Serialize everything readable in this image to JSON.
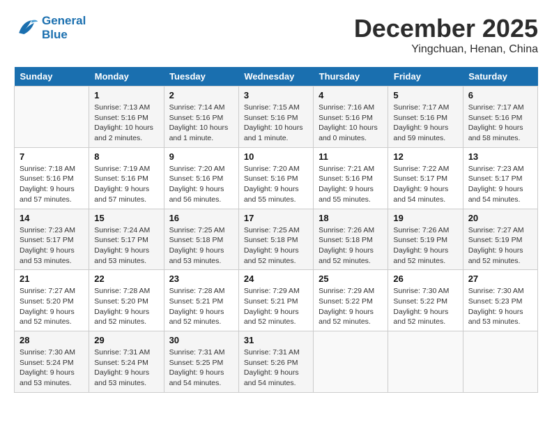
{
  "logo": {
    "line1": "General",
    "line2": "Blue"
  },
  "title": "December 2025",
  "location": "Yingchuan, Henan, China",
  "days_of_week": [
    "Sunday",
    "Monday",
    "Tuesday",
    "Wednesday",
    "Thursday",
    "Friday",
    "Saturday"
  ],
  "weeks": [
    [
      {
        "day": "",
        "info": ""
      },
      {
        "day": "1",
        "info": "Sunrise: 7:13 AM\nSunset: 5:16 PM\nDaylight: 10 hours\nand 2 minutes."
      },
      {
        "day": "2",
        "info": "Sunrise: 7:14 AM\nSunset: 5:16 PM\nDaylight: 10 hours\nand 1 minute."
      },
      {
        "day": "3",
        "info": "Sunrise: 7:15 AM\nSunset: 5:16 PM\nDaylight: 10 hours\nand 1 minute."
      },
      {
        "day": "4",
        "info": "Sunrise: 7:16 AM\nSunset: 5:16 PM\nDaylight: 10 hours\nand 0 minutes."
      },
      {
        "day": "5",
        "info": "Sunrise: 7:17 AM\nSunset: 5:16 PM\nDaylight: 9 hours\nand 59 minutes."
      },
      {
        "day": "6",
        "info": "Sunrise: 7:17 AM\nSunset: 5:16 PM\nDaylight: 9 hours\nand 58 minutes."
      }
    ],
    [
      {
        "day": "7",
        "info": "Sunrise: 7:18 AM\nSunset: 5:16 PM\nDaylight: 9 hours\nand 57 minutes."
      },
      {
        "day": "8",
        "info": "Sunrise: 7:19 AM\nSunset: 5:16 PM\nDaylight: 9 hours\nand 57 minutes."
      },
      {
        "day": "9",
        "info": "Sunrise: 7:20 AM\nSunset: 5:16 PM\nDaylight: 9 hours\nand 56 minutes."
      },
      {
        "day": "10",
        "info": "Sunrise: 7:20 AM\nSunset: 5:16 PM\nDaylight: 9 hours\nand 55 minutes."
      },
      {
        "day": "11",
        "info": "Sunrise: 7:21 AM\nSunset: 5:16 PM\nDaylight: 9 hours\nand 55 minutes."
      },
      {
        "day": "12",
        "info": "Sunrise: 7:22 AM\nSunset: 5:17 PM\nDaylight: 9 hours\nand 54 minutes."
      },
      {
        "day": "13",
        "info": "Sunrise: 7:23 AM\nSunset: 5:17 PM\nDaylight: 9 hours\nand 54 minutes."
      }
    ],
    [
      {
        "day": "14",
        "info": "Sunrise: 7:23 AM\nSunset: 5:17 PM\nDaylight: 9 hours\nand 53 minutes."
      },
      {
        "day": "15",
        "info": "Sunrise: 7:24 AM\nSunset: 5:17 PM\nDaylight: 9 hours\nand 53 minutes."
      },
      {
        "day": "16",
        "info": "Sunrise: 7:25 AM\nSunset: 5:18 PM\nDaylight: 9 hours\nand 53 minutes."
      },
      {
        "day": "17",
        "info": "Sunrise: 7:25 AM\nSunset: 5:18 PM\nDaylight: 9 hours\nand 52 minutes."
      },
      {
        "day": "18",
        "info": "Sunrise: 7:26 AM\nSunset: 5:18 PM\nDaylight: 9 hours\nand 52 minutes."
      },
      {
        "day": "19",
        "info": "Sunrise: 7:26 AM\nSunset: 5:19 PM\nDaylight: 9 hours\nand 52 minutes."
      },
      {
        "day": "20",
        "info": "Sunrise: 7:27 AM\nSunset: 5:19 PM\nDaylight: 9 hours\nand 52 minutes."
      }
    ],
    [
      {
        "day": "21",
        "info": "Sunrise: 7:27 AM\nSunset: 5:20 PM\nDaylight: 9 hours\nand 52 minutes."
      },
      {
        "day": "22",
        "info": "Sunrise: 7:28 AM\nSunset: 5:20 PM\nDaylight: 9 hours\nand 52 minutes."
      },
      {
        "day": "23",
        "info": "Sunrise: 7:28 AM\nSunset: 5:21 PM\nDaylight: 9 hours\nand 52 minutes."
      },
      {
        "day": "24",
        "info": "Sunrise: 7:29 AM\nSunset: 5:21 PM\nDaylight: 9 hours\nand 52 minutes."
      },
      {
        "day": "25",
        "info": "Sunrise: 7:29 AM\nSunset: 5:22 PM\nDaylight: 9 hours\nand 52 minutes."
      },
      {
        "day": "26",
        "info": "Sunrise: 7:30 AM\nSunset: 5:22 PM\nDaylight: 9 hours\nand 52 minutes."
      },
      {
        "day": "27",
        "info": "Sunrise: 7:30 AM\nSunset: 5:23 PM\nDaylight: 9 hours\nand 53 minutes."
      }
    ],
    [
      {
        "day": "28",
        "info": "Sunrise: 7:30 AM\nSunset: 5:24 PM\nDaylight: 9 hours\nand 53 minutes."
      },
      {
        "day": "29",
        "info": "Sunrise: 7:31 AM\nSunset: 5:24 PM\nDaylight: 9 hours\nand 53 minutes."
      },
      {
        "day": "30",
        "info": "Sunrise: 7:31 AM\nSunset: 5:25 PM\nDaylight: 9 hours\nand 54 minutes."
      },
      {
        "day": "31",
        "info": "Sunrise: 7:31 AM\nSunset: 5:26 PM\nDaylight: 9 hours\nand 54 minutes."
      },
      {
        "day": "",
        "info": ""
      },
      {
        "day": "",
        "info": ""
      },
      {
        "day": "",
        "info": ""
      }
    ]
  ]
}
